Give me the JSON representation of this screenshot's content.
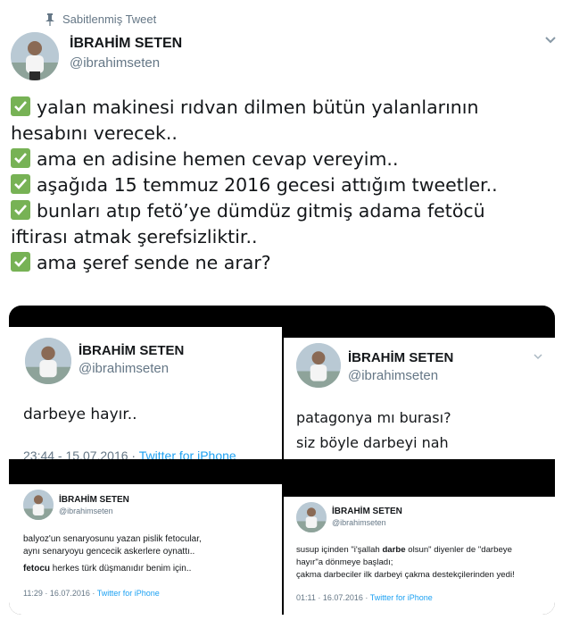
{
  "pinned": {
    "label": "Sabitlenmiş Tweet",
    "icon": "pin-icon"
  },
  "author": {
    "name": "İBRAHİM SETEN",
    "handle": "@ibrahimseten"
  },
  "tweet": {
    "lines": [
      {
        "check": true,
        "text": "yalan makinesi rıdvan dilmen bütün yalanlarının"
      },
      {
        "check": false,
        "text": "hesabını verecek.."
      },
      {
        "check": true,
        "text": "ama en adisine hemen cevap vereyim.."
      },
      {
        "check": true,
        "text": "aşağıda 15 temmuz 2016 gecesi attığım tweetler.."
      },
      {
        "check": true,
        "text": "bunları atıp fetö’ye dümdüz gitmiş adama fetöcü"
      },
      {
        "check": false,
        "text": "iftirası atmak şerefsizliktir.."
      },
      {
        "check": true,
        "text": "ama şeref sende ne arar?"
      }
    ]
  },
  "screenshots": {
    "top_left": {
      "name": "İBRAHİM SETEN",
      "handle": "@ibrahimseten",
      "text": "darbeye hayır..",
      "meta_time": "23:44 - 15.07.2016",
      "meta_source": "Twitter for iPhone"
    },
    "top_right": {
      "name": "İBRAHİM SETEN",
      "handle": "@ibrahimseten",
      "line1": "patagonya mı burası?",
      "line2": "siz böyle darbeyi nah"
    },
    "bottom_left": {
      "name": "İBRAHİM SETEN",
      "handle": "@ibrahimseten",
      "line1": "balyoz'un senaryosunu yazan pislik fetocular,",
      "line2": "aynı senaryoyu gencecik askerlere oynattı..",
      "line3_bold": "fetocu",
      "line3_rest": " herkes türk düşmanıdır benim için..",
      "meta_time": "11:29 · 16.07.2016 · ",
      "meta_source": "Twitter for iPhone"
    },
    "bottom_right": {
      "name": "İBRAHİM SETEN",
      "handle": "@ibrahimseten",
      "line1_a": "susup içinden \"i'şallah ",
      "line1_bold": "darbe",
      "line1_b": " olsun\" diyenler de \"darbeye",
      "line2": "hayır\"a dönmeye başladı;",
      "line3": "çakma darbeciler ilk darbeyi çakma destekçilerinden yedi!",
      "meta_time": "01:11 · 16.07.2016 · ",
      "meta_source": "Twitter for iPhone"
    }
  },
  "colors": {
    "check_green": "#77b255",
    "link_blue": "#1da1f2",
    "muted": "#657786"
  }
}
